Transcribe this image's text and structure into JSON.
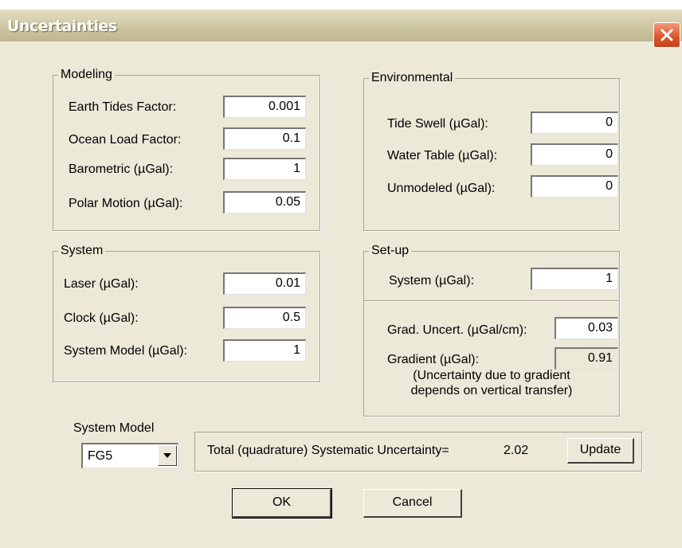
{
  "window": {
    "title": "Uncertainties"
  },
  "modeling": {
    "legend": "Modeling",
    "earth_tides": {
      "label": "Earth Tides Factor:",
      "value": "0.001"
    },
    "ocean_load": {
      "label": "Ocean Load Factor:",
      "value": "0.1"
    },
    "barometric": {
      "label": "Barometric (µGal):",
      "value": "1"
    },
    "polar_motion": {
      "label": "Polar Motion (µGal):",
      "value": "0.05"
    }
  },
  "environmental": {
    "legend": "Environmental",
    "tide_swell": {
      "label": "Tide Swell (µGal):",
      "value": "0"
    },
    "water_table": {
      "label": "Water Table (µGal):",
      "value": "0"
    },
    "unmodeled": {
      "label": "Unmodeled (µGal):",
      "value": "0"
    }
  },
  "system": {
    "legend": "System",
    "laser": {
      "label": "Laser (µGal):",
      "value": "0.01"
    },
    "clock": {
      "label": "Clock (µGal):",
      "value": "0.5"
    },
    "system_model": {
      "label": "System Model (µGal):",
      "value": "1"
    }
  },
  "setup": {
    "legend": "Set-up",
    "system": {
      "label": "System (µGal):",
      "value": "1"
    },
    "grad_uncert": {
      "label": "Grad. Uncert. (µGal/cm):",
      "value": "0.03"
    },
    "gradient": {
      "label": "Gradient (µGal):",
      "value": "0.91"
    },
    "note_line1": "(Uncertainty due to gradient",
    "note_line2": "depends on vertical transfer)"
  },
  "system_model_select": {
    "label": "System Model",
    "selected": "FG5"
  },
  "total": {
    "label": "Total (quadrature) Systematic Uncertainty=",
    "value": "2.02",
    "update_label": "Update"
  },
  "buttons": {
    "ok": "OK",
    "cancel": "Cancel"
  },
  "icons": {
    "close": "close-icon",
    "dropdown": "chevron-down-icon"
  },
  "colors": {
    "close_button": "#d9542c",
    "dialog_background": "#ece9d8"
  }
}
